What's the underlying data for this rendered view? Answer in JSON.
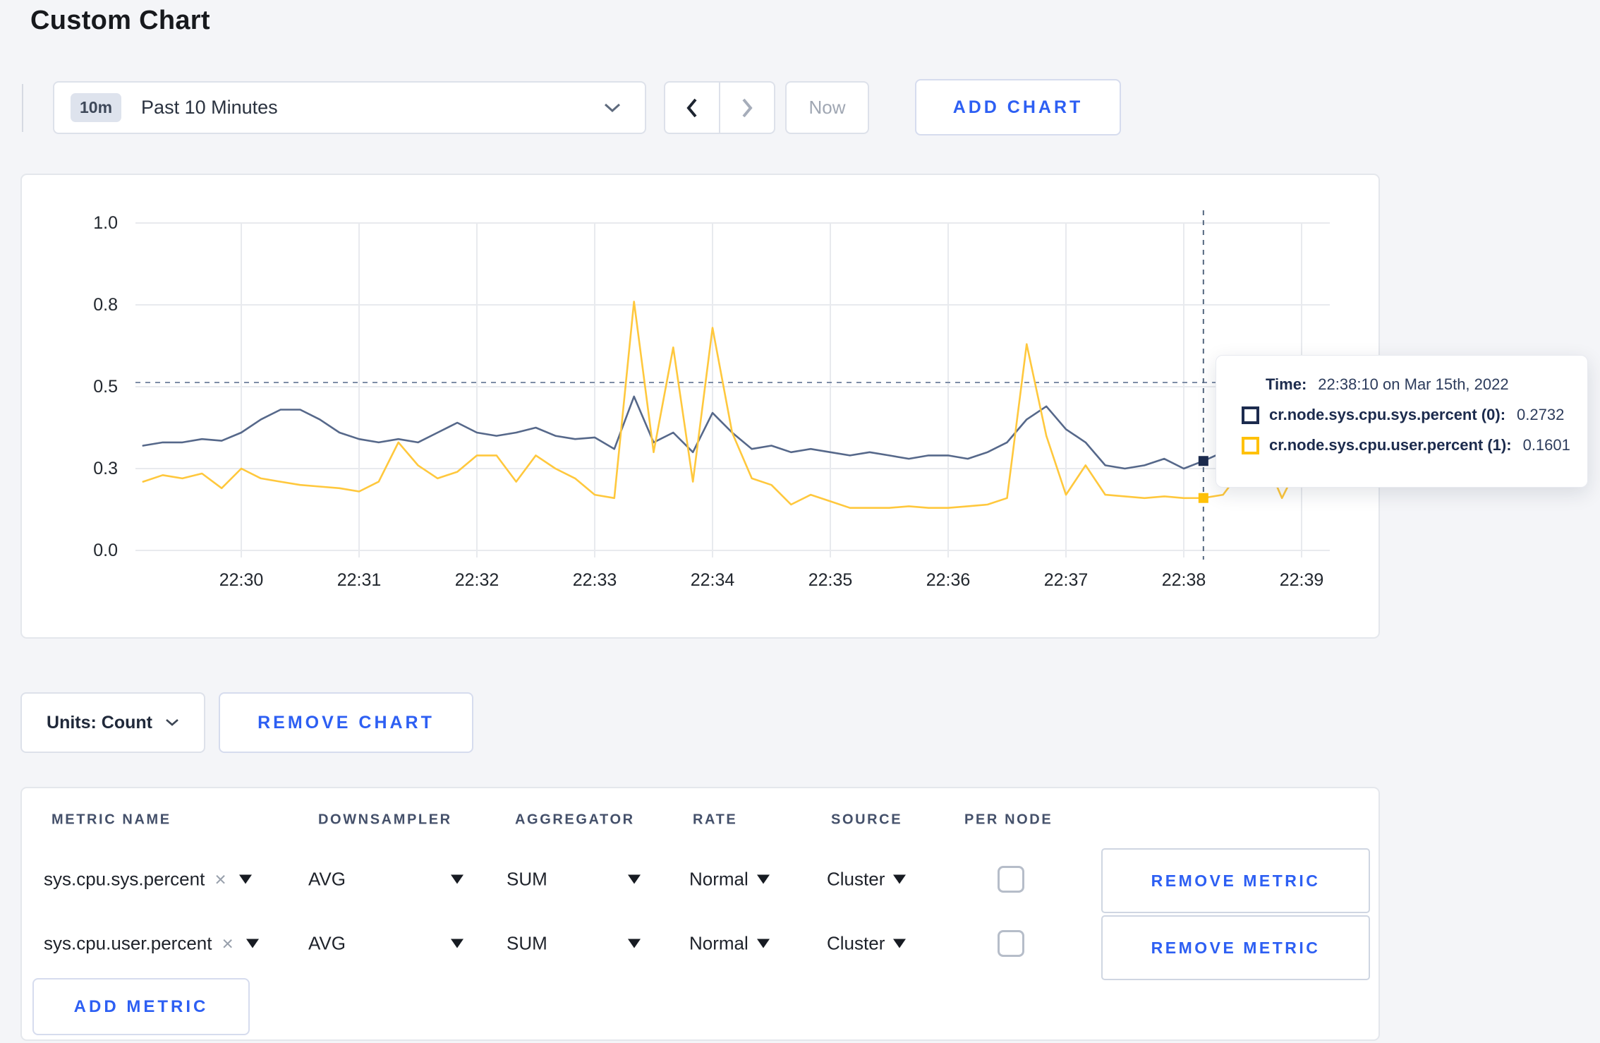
{
  "page": {
    "title": "Custom Chart"
  },
  "icons": {
    "close": "×",
    "caret_down": ""
  },
  "toolbar": {
    "time_picker": {
      "badge": "10m",
      "label": "Past 10 Minutes"
    },
    "now_label": "Now",
    "add_chart_label": "ADD CHART"
  },
  "chart_card": {
    "units_label": "Units: Count",
    "remove_chart_label": "REMOVE CHART"
  },
  "chart_data": {
    "type": "line",
    "title": "",
    "xlabel": "",
    "ylabel": "",
    "ylim": [
      0,
      1
    ],
    "grid": true,
    "legend_position": "none",
    "x_start": "22:29:10",
    "x_step_seconds": 10,
    "x_tick_labels": [
      "22:30",
      "22:31",
      "22:32",
      "22:33",
      "22:34",
      "22:35",
      "22:36",
      "22:37",
      "22:38",
      "22:39"
    ],
    "y_ticks": [
      0,
      0.25,
      0.5,
      0.75,
      1.0
    ],
    "y_tick_labels": [
      "0.0",
      "0.3",
      "0.5",
      "0.8",
      "1.0"
    ],
    "series": [
      {
        "name": "cr.node.sys.cpu.sys.percent (0)",
        "color": "#56688A",
        "values": [
          0.32,
          0.33,
          0.33,
          0.34,
          0.335,
          0.36,
          0.4,
          0.43,
          0.43,
          0.4,
          0.36,
          0.34,
          0.33,
          0.34,
          0.33,
          0.36,
          0.39,
          0.36,
          0.35,
          0.36,
          0.375,
          0.35,
          0.34,
          0.345,
          0.31,
          0.47,
          0.33,
          0.36,
          0.3,
          0.42,
          0.36,
          0.31,
          0.32,
          0.3,
          0.31,
          0.3,
          0.29,
          0.3,
          0.29,
          0.28,
          0.29,
          0.29,
          0.28,
          0.3,
          0.33,
          0.4,
          0.44,
          0.37,
          0.33,
          0.26,
          0.25,
          0.26,
          0.28,
          0.25,
          0.2732,
          0.3,
          0.31,
          0.3,
          0.29,
          0.3,
          0.31
        ]
      },
      {
        "name": "cr.node.sys.cpu.user.percent (1)",
        "color": "#FFC83D",
        "values": [
          0.21,
          0.23,
          0.22,
          0.235,
          0.19,
          0.25,
          0.22,
          0.21,
          0.2,
          0.195,
          0.19,
          0.18,
          0.21,
          0.33,
          0.26,
          0.22,
          0.24,
          0.29,
          0.29,
          0.21,
          0.29,
          0.25,
          0.22,
          0.17,
          0.16,
          0.76,
          0.3,
          0.62,
          0.21,
          0.68,
          0.36,
          0.22,
          0.2,
          0.14,
          0.17,
          0.15,
          0.13,
          0.13,
          0.13,
          0.135,
          0.13,
          0.13,
          0.135,
          0.14,
          0.16,
          0.63,
          0.35,
          0.17,
          0.26,
          0.17,
          0.165,
          0.16,
          0.165,
          0.16,
          0.1601,
          0.17,
          0.25,
          0.3,
          0.16,
          0.28,
          0.24
        ]
      }
    ],
    "hover": {
      "time": "22:38:10",
      "index": 54,
      "guideline_y": 0.513,
      "marker_colors": [
        "#1C2B4E",
        "#FFC107"
      ]
    }
  },
  "tooltip": {
    "time_label": "Time:",
    "time_value": "22:38:10 on Mar 15th, 2022",
    "entries": [
      {
        "name": "cr.node.sys.cpu.sys.percent (0):",
        "value": "0.2732",
        "color": "#1C2B4E"
      },
      {
        "name": "cr.node.sys.cpu.user.percent (1):",
        "value": "0.1601",
        "color": "#FFC107"
      }
    ]
  },
  "metrics_table": {
    "headers": [
      "METRIC NAME",
      "DOWNSAMPLER",
      "AGGREGATOR",
      "RATE",
      "SOURCE",
      "PER NODE"
    ],
    "rows": [
      {
        "metric": "sys.cpu.sys.percent",
        "downsampler": "AVG",
        "aggregator": "SUM",
        "rate": "Normal",
        "source": "Cluster",
        "per_node_checked": false,
        "remove_label": "REMOVE METRIC"
      },
      {
        "metric": "sys.cpu.user.percent",
        "downsampler": "AVG",
        "aggregator": "SUM",
        "rate": "Normal",
        "source": "Cluster",
        "per_node_checked": false,
        "remove_label": "REMOVE METRIC"
      }
    ],
    "add_metric_label": "ADD METRIC"
  }
}
